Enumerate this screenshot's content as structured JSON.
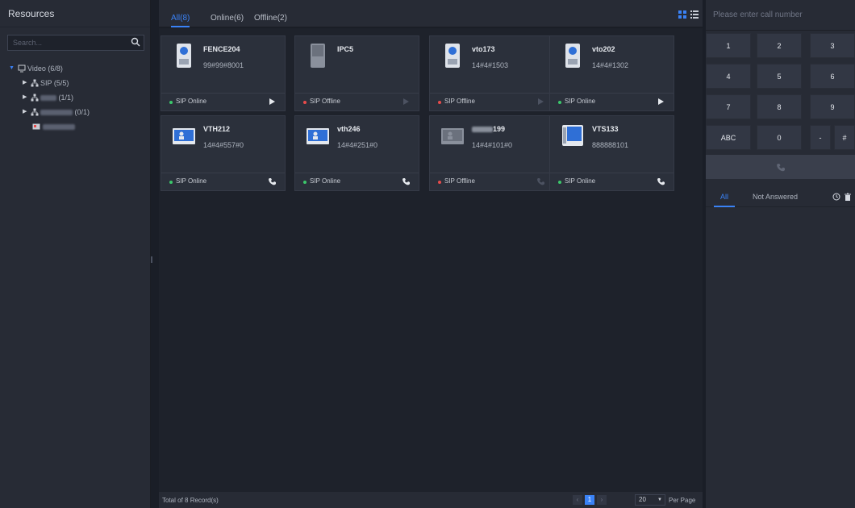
{
  "resources_panel": {
    "title": "Resources",
    "search_placeholder": "Search...",
    "tree": [
      {
        "label": "Video (6/8)",
        "expanded": true,
        "icon": "monitor-icon"
      },
      {
        "label": "SIP (5/5)",
        "expanded": false,
        "icon": "org-node-icon"
      },
      {
        "label_suffix": "(1/1)",
        "expanded": false,
        "icon": "org-node-icon",
        "label_obscured": true
      },
      {
        "label_suffix": "(0/1)",
        "expanded": false,
        "icon": "org-node-icon",
        "label_obscured": true
      },
      {
        "label_obscured": true,
        "icon": "device-icon"
      }
    ]
  },
  "tabs": [
    {
      "label": "All(8)",
      "active": true
    },
    {
      "label": "Online(6)",
      "active": false
    },
    {
      "label": "Offline(2)",
      "active": false
    }
  ],
  "view_toggle": {
    "grid_icon": "grid-view-icon",
    "list_icon": "list-view-icon",
    "active": "grid"
  },
  "devices": [
    {
      "name": "FENCE204",
      "number": "99#99#8001",
      "status": "SIP Online",
      "online": true,
      "type": "door-station-icon",
      "action": "play-icon",
      "action_enabled": true
    },
    {
      "name": "IPC5",
      "number": "",
      "status": "SIP Offline",
      "online": false,
      "type": "ipc-camera-icon",
      "action": "play-icon",
      "action_enabled": false
    },
    {
      "name": "vto173",
      "number": "14#4#1503",
      "status": "SIP Offline",
      "online": false,
      "type": "door-station-icon",
      "action": "play-icon",
      "action_enabled": false
    },
    {
      "name": "vto202",
      "number": "14#4#1302",
      "status": "SIP Online",
      "online": true,
      "type": "door-station-icon",
      "action": "play-icon",
      "action_enabled": true
    },
    {
      "name": "VTH212",
      "number": "14#4#557#0",
      "status": "SIP Online",
      "online": true,
      "type": "indoor-monitor-icon",
      "action": "phone-icon",
      "action_enabled": true
    },
    {
      "name": "vth246",
      "number": "14#4#251#0",
      "status": "SIP Online",
      "online": true,
      "type": "indoor-monitor-icon",
      "action": "phone-icon",
      "action_enabled": true
    },
    {
      "name": "199",
      "name_prefix_obscured": true,
      "number": "14#4#101#0",
      "status": "SIP Offline",
      "online": false,
      "type": "indoor-monitor-icon",
      "action": "phone-icon",
      "action_enabled": false
    },
    {
      "name": "VTS133",
      "number": "888888101",
      "status": "SIP Online",
      "online": true,
      "type": "management-station-icon",
      "action": "phone-icon",
      "action_enabled": true
    }
  ],
  "footer": {
    "total_text": "Total of 8 Record(s)",
    "current_page": "1",
    "page_size": "20",
    "per_page_label": "Per Page"
  },
  "dialer": {
    "placeholder": "Please enter call number",
    "keys": [
      "1",
      "2",
      "3",
      "4",
      "5",
      "6",
      "7",
      "8",
      "9",
      "ABC",
      "0",
      "-",
      "#"
    ],
    "call_icon": "phone-icon"
  },
  "call_log": {
    "tabs": [
      {
        "label": "All",
        "active": true
      },
      {
        "label": "Not Answered",
        "active": false
      }
    ],
    "history_icon": "clock-icon",
    "delete_icon": "trash-icon"
  },
  "colors": {
    "accent": "#3a82f6",
    "online": "#3bc86b",
    "offline": "#e84b4b",
    "panel": "#272b35",
    "background": "#1e222b"
  }
}
